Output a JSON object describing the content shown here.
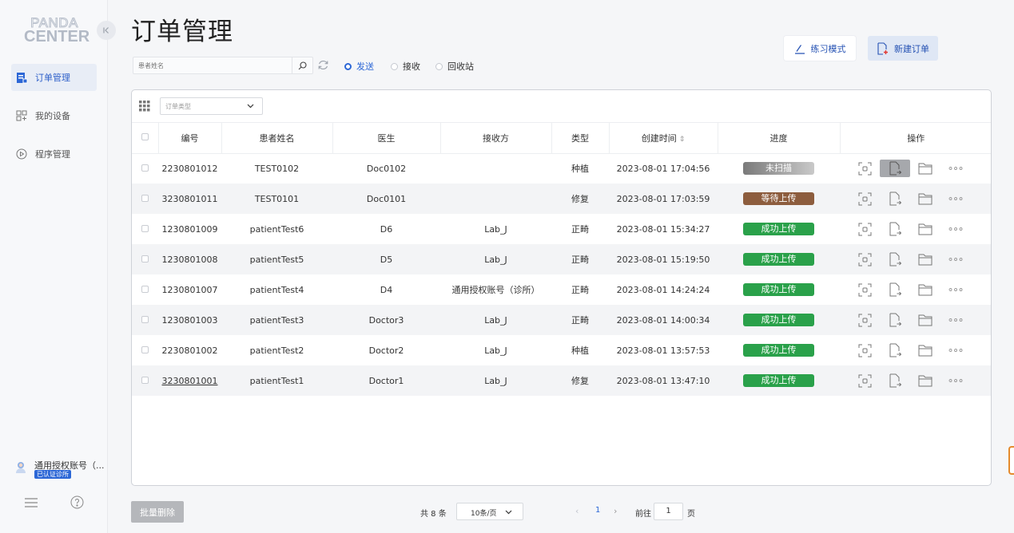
{
  "sidebar": {
    "logo_line1": "PANDA",
    "logo_line2": "CENTER",
    "items": [
      {
        "label": "订单管理",
        "icon": "order-list-icon",
        "active": true
      },
      {
        "label": "我的设备",
        "icon": "device-grid-icon",
        "active": false
      },
      {
        "label": "程序管理",
        "icon": "play-circle-icon",
        "active": false
      }
    ],
    "user": {
      "name": "通用授权账号（...",
      "badge": "已认证诊所"
    }
  },
  "header": {
    "title": "订单管理",
    "practice_label": "练习模式",
    "new_order_label": "新建订单"
  },
  "filters": {
    "search_placeholder": "患者姓名",
    "radios": [
      {
        "label": "发送",
        "selected": true
      },
      {
        "label": "接收",
        "selected": false
      },
      {
        "label": "回收站",
        "selected": false
      }
    ],
    "order_type_placeholder": "订单类型"
  },
  "table": {
    "columns": [
      "编号",
      "患者姓名",
      "医生",
      "接收方",
      "类型",
      "创建时间",
      "进度",
      "操作"
    ],
    "rows": [
      {
        "id": "2230801012",
        "patient": "TEST0102",
        "doctor": "Doc0102",
        "receiver": "",
        "type": "种植",
        "created": "2023-08-01 17:04:56",
        "progress": "未扫描",
        "status": "gray"
      },
      {
        "id": "3230801011",
        "patient": "TEST0101",
        "doctor": "Doc0101",
        "receiver": "",
        "type": "修复",
        "created": "2023-08-01 17:03:59",
        "progress": "等待上传",
        "status": "brown"
      },
      {
        "id": "1230801009",
        "patient": "patientTest6",
        "doctor": "D6",
        "receiver": "Lab_J",
        "type": "正畸",
        "created": "2023-08-01 15:34:27",
        "progress": "成功上传",
        "status": "green"
      },
      {
        "id": "1230801008",
        "patient": "patientTest5",
        "doctor": "D5",
        "receiver": "Lab_J",
        "type": "正畸",
        "created": "2023-08-01 15:19:50",
        "progress": "成功上传",
        "status": "green"
      },
      {
        "id": "1230801007",
        "patient": "patientTest4",
        "doctor": "D4",
        "receiver": "通用授权账号（诊所）",
        "type": "正畸",
        "created": "2023-08-01 14:24:24",
        "progress": "成功上传",
        "status": "green"
      },
      {
        "id": "1230801003",
        "patient": "patientTest3",
        "doctor": "Doctor3",
        "receiver": "Lab_J",
        "type": "正畸",
        "created": "2023-08-01 14:00:34",
        "progress": "成功上传",
        "status": "green"
      },
      {
        "id": "2230801002",
        "patient": "patientTest2",
        "doctor": "Doctor2",
        "receiver": "Lab_J",
        "type": "种植",
        "created": "2023-08-01 13:57:53",
        "progress": "成功上传",
        "status": "green"
      },
      {
        "id": "3230801001",
        "patient": "patientTest1",
        "doctor": "Doctor1",
        "receiver": "Lab_J",
        "type": "修复",
        "created": "2023-08-01 13:47:10",
        "progress": "成功上传",
        "status": "green"
      }
    ]
  },
  "footer": {
    "batch_delete": "批量删除",
    "total": "共 8 条",
    "page_size": "10条/页",
    "current_page": "1",
    "goto_prefix": "前往",
    "goto_value": "1",
    "goto_suffix": "页"
  },
  "colors": {
    "accent": "#2c67d6",
    "success": "#2aa14a",
    "waiting": "#8d5d3e",
    "unscanned": "#9a9a9a"
  }
}
